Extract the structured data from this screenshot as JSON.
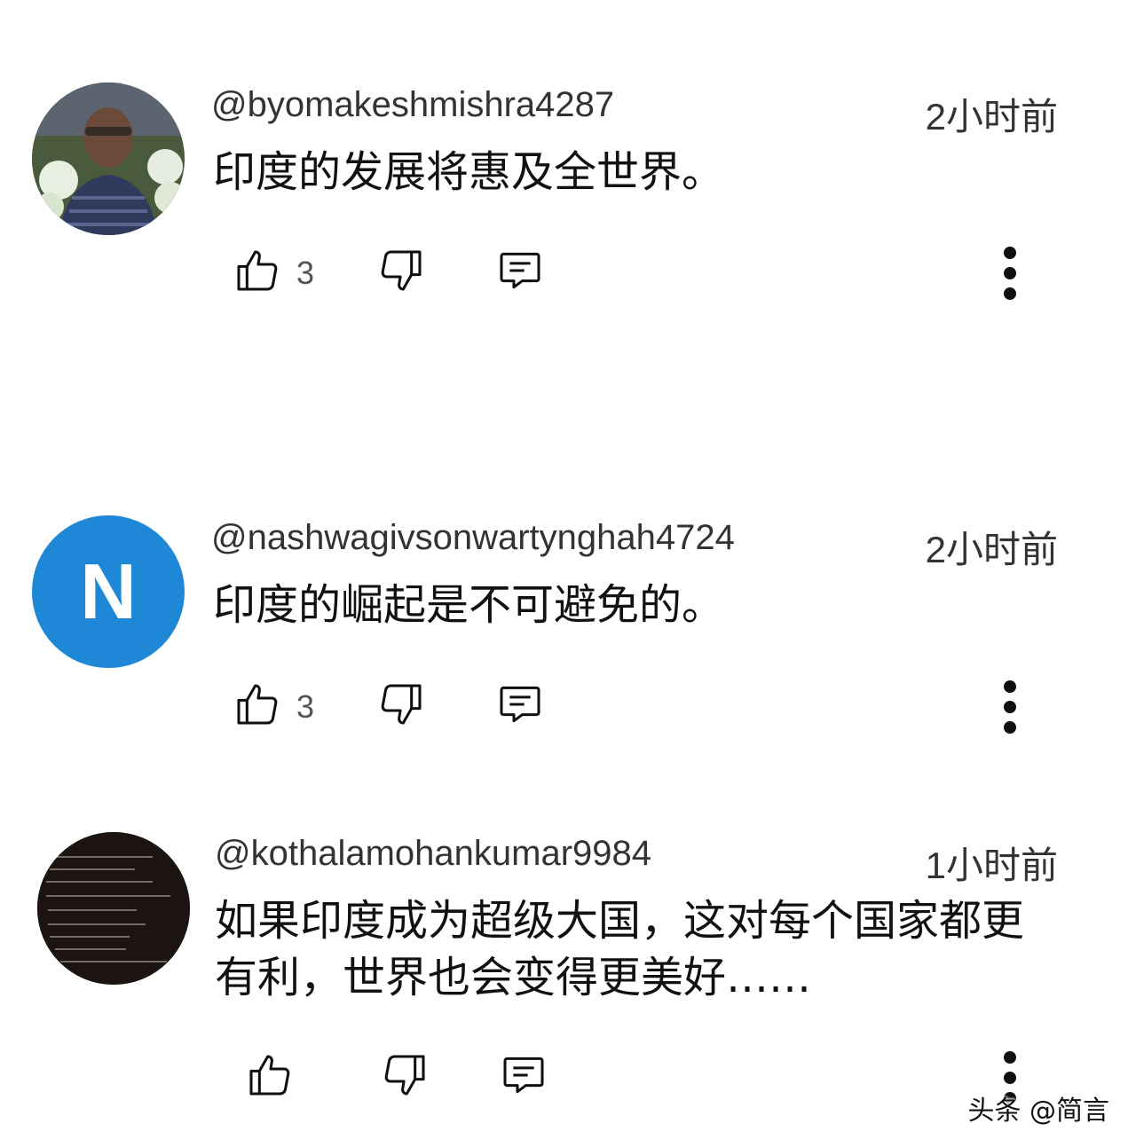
{
  "comments": [
    {
      "handle": "@byomakeshmishra4287",
      "time": "2小时前",
      "text": "印度的发展将惠及全世界。",
      "likes": "3",
      "avatar_type": "photo"
    },
    {
      "handle": "@nashwagivsonwartynghah4724",
      "time": "2小时前",
      "text": "印度的崛起是不可避免的。",
      "likes": "3",
      "avatar_type": "letter",
      "avatar_letter": "N",
      "avatar_color": "#1e88d6"
    },
    {
      "handle": "@kothalamohankumar9984",
      "time": "1小时前",
      "text": "如果印度成为超级大国，这对每个国家都更\n有利，世界也会变得更美好……",
      "likes": "",
      "avatar_type": "dark"
    }
  ],
  "icons": {
    "like": "thumbs-up-icon",
    "dislike": "thumbs-down-icon",
    "reply": "comment-icon",
    "more": "more-vert-icon"
  },
  "watermark": "头条 @简言"
}
